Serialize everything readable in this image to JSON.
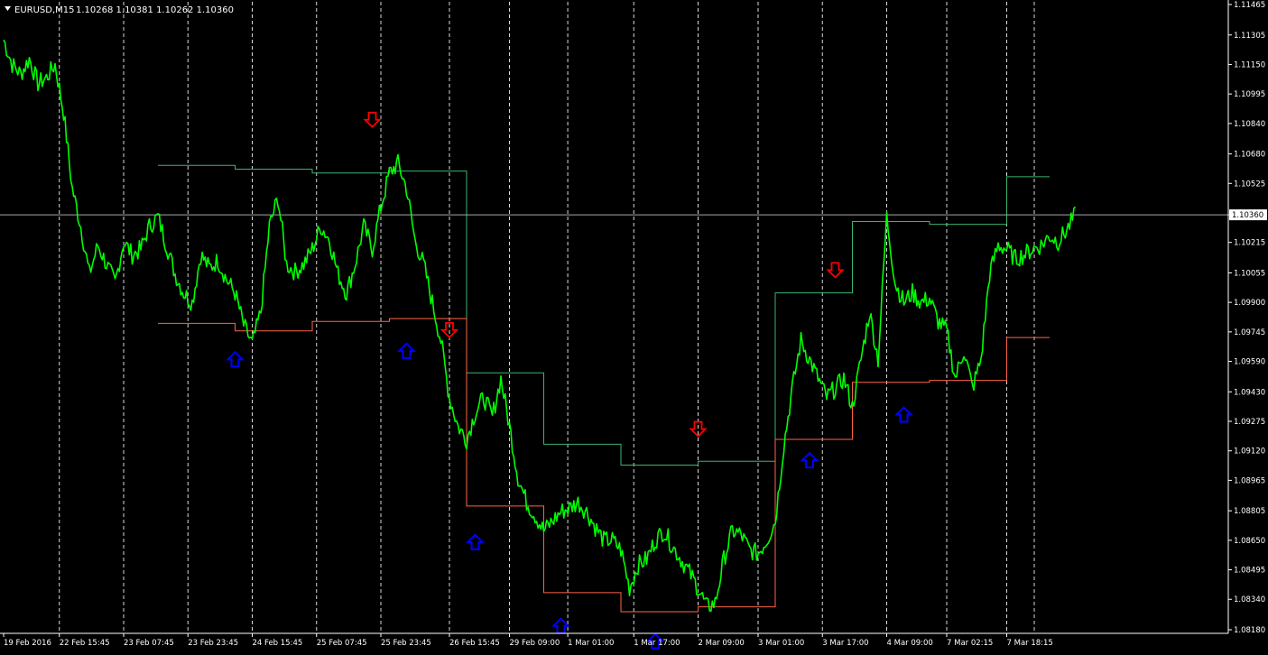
{
  "header": {
    "symbol": "EURUSD,M15",
    "ohlc": "1.10268 1.10381 1.10262 1.10360"
  },
  "colors": {
    "background": "#000000",
    "price_line": "#00ff00",
    "grid": "#ffffff",
    "upper_level": "#3cb371",
    "lower_level": "#ff6347",
    "sell_arrow": "#ff0000",
    "buy_arrow": "#0000ff",
    "current_price_line": "#a9a9a9",
    "axis_text": "#ffffff"
  },
  "chart_data": {
    "type": "line",
    "grid": true,
    "ylim": [
      1.0818,
      1.115
    ],
    "current_price": 1.1036,
    "y_ticks": [
      "1.11465",
      "1.11305",
      "1.11150",
      "1.10995",
      "1.10840",
      "1.10680",
      "1.10525",
      "1.10360",
      "1.10215",
      "1.10055",
      "1.09900",
      "1.09745",
      "1.09590",
      "1.09430",
      "1.09275",
      "1.09120",
      "1.08965",
      "1.08805",
      "1.08650",
      "1.08495",
      "1.08340",
      "1.08180"
    ],
    "x_ticks": [
      "19 Feb 2016",
      "22 Feb 15:45",
      "23 Feb 07:45",
      "23 Feb 23:45",
      "24 Feb 15:45",
      "25 Feb 07:45",
      "25 Feb 23:45",
      "26 Feb 15:45",
      "29 Feb 09:00",
      "1 Mar 01:00",
      "1 Mar 17:00",
      "2 Mar 09:00",
      "3 Mar 01:00",
      "3 Mar 17:00",
      "4 Mar 09:00",
      "7 Mar 02:15",
      "7 Mar 18:15"
    ],
    "x_ticks_at_bar": [
      0,
      6.5,
      14.0,
      21.5,
      29.0,
      36.5,
      44.0,
      52.0,
      59.0,
      65.8,
      73.5,
      81.0,
      88.0,
      95.5,
      103.0,
      110.0,
      117.0
    ],
    "bar_count": 126,
    "series": [
      {
        "values": [
          1.1128,
          1.1115,
          1.111,
          1.1118,
          1.1105,
          1.1108,
          1.1115,
          1.109,
          1.105,
          1.103,
          1.1005,
          1.102,
          1.101,
          1.1,
          1.1022,
          1.1015,
          1.1018,
          1.103,
          1.1035,
          1.102,
          1.1005,
          1.0995,
          1.099,
          1.1015,
          1.1008,
          1.1012,
          1.1002,
          1.0995,
          1.0978,
          1.0968,
          1.0985,
          1.103,
          1.1045,
          1.101,
          1.1006,
          1.101,
          1.1018,
          1.103,
          1.1023,
          1.1005,
          1.0995,
          1.101,
          1.103,
          1.1018,
          1.104,
          1.1058,
          1.1063,
          1.105,
          1.1022,
          1.101,
          1.099,
          1.097,
          1.094,
          1.0925,
          1.0918,
          1.0932,
          1.094,
          1.093,
          1.095,
          1.0925,
          1.0898,
          1.0885,
          1.0878,
          1.087,
          1.0875,
          1.088,
          1.0882,
          1.0885,
          1.088,
          1.0872,
          1.0865,
          1.0865,
          1.086,
          1.084,
          1.0852,
          1.0855,
          1.0865,
          1.087,
          1.0862,
          1.0855,
          1.0848,
          1.084,
          1.083,
          1.0832,
          1.0855,
          1.087,
          1.0868,
          1.086,
          1.0858,
          1.0865,
          1.0875,
          1.0915,
          1.0945,
          1.097,
          1.096,
          1.095,
          1.094,
          1.0945,
          1.095,
          1.0935,
          1.096,
          1.0985,
          1.096,
          1.1035,
          1.1,
          1.099,
          1.0995,
          1.099,
          1.0992,
          1.098,
          1.0975,
          1.095,
          1.0965,
          1.0945,
          1.096,
          1.1005,
          1.102,
          1.1018,
          1.1013,
          1.1015,
          1.1018,
          1.102,
          1.1025,
          1.1022,
          1.1028,
          1.1036
        ]
      }
    ],
    "upper_levels": [
      {
        "from": 18,
        "to": 27,
        "value": 1.1062
      },
      {
        "from": 27,
        "to": 36,
        "value": 1.106
      },
      {
        "from": 36,
        "to": 45,
        "value": 1.1058
      },
      {
        "from": 45,
        "to": 54,
        "value": 1.1059
      },
      {
        "from": 54,
        "to": 63,
        "value": 1.0953
      },
      {
        "from": 63,
        "to": 72,
        "value": 1.09155
      },
      {
        "from": 72,
        "to": 81,
        "value": 1.09045
      },
      {
        "from": 81,
        "to": 90,
        "value": 1.09065
      },
      {
        "from": 90,
        "to": 99,
        "value": 1.0995
      },
      {
        "from": 99,
        "to": 108,
        "value": 1.10325
      },
      {
        "from": 108,
        "to": 117,
        "value": 1.1031
      },
      {
        "from": 117,
        "to": 122,
        "value": 1.1056
      }
    ],
    "lower_levels": [
      {
        "from": 18,
        "to": 27,
        "value": 1.0979
      },
      {
        "from": 27,
        "to": 36,
        "value": 1.0975
      },
      {
        "from": 36,
        "to": 45,
        "value": 1.098
      },
      {
        "from": 45,
        "to": 54,
        "value": 1.09815
      },
      {
        "from": 54,
        "to": 63,
        "value": 1.0883
      },
      {
        "from": 63,
        "to": 72,
        "value": 1.08375
      },
      {
        "from": 72,
        "to": 81,
        "value": 1.08275
      },
      {
        "from": 81,
        "to": 90,
        "value": 1.083
      },
      {
        "from": 90,
        "to": 99,
        "value": 1.0918
      },
      {
        "from": 99,
        "to": 108,
        "value": 1.0948
      },
      {
        "from": 108,
        "to": 117,
        "value": 1.0949
      },
      {
        "from": 117,
        "to": 122,
        "value": 1.09715
      }
    ],
    "sell_arrows": [
      {
        "bar": 43,
        "price": 1.1085
      },
      {
        "bar": 52,
        "price": 1.09745
      },
      {
        "bar": 81,
        "price": 1.09225
      },
      {
        "bar": 97,
        "price": 1.1006
      }
    ],
    "buy_arrows": [
      {
        "bar": 27,
        "price": 1.0961
      },
      {
        "bar": 47,
        "price": 1.09655
      },
      {
        "bar": 55,
        "price": 1.0865
      },
      {
        "bar": 65,
        "price": 1.0821
      },
      {
        "bar": 76,
        "price": 1.0813
      },
      {
        "bar": 94,
        "price": 1.0908
      },
      {
        "bar": 105,
        "price": 1.0932
      }
    ]
  }
}
